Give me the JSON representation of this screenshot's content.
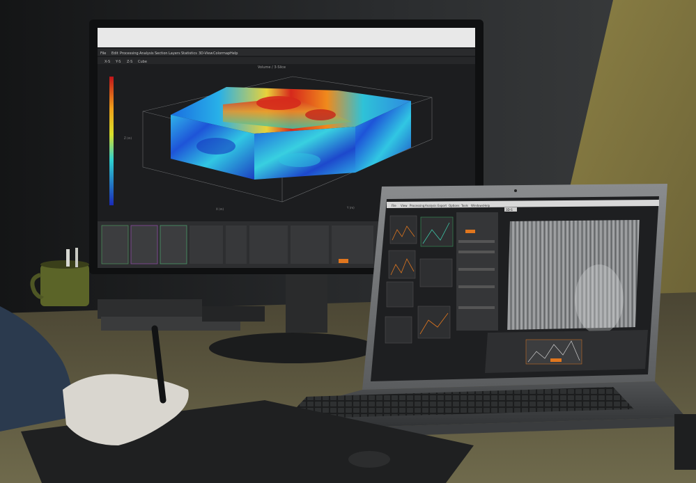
{
  "monitor_app": {
    "title": "",
    "menu": [
      "File",
      "Edit",
      "Processing",
      "Analysis",
      "Section",
      "Layers",
      "Statistics",
      "3D-View",
      "Colormap",
      "Help"
    ],
    "toolbar_tabs": [
      "X-S",
      "Y-S",
      "Z-S",
      "Cube"
    ],
    "plot_title": "Volume / 3-Slice",
    "z_axis_label": "Z (m)",
    "x_axis_label": "X (m)",
    "y_axis_label": "Y (m)"
  },
  "laptop_app": {
    "menu": [
      "File",
      "View",
      "Processing",
      "Analysis",
      "Export",
      "Options",
      "Tools",
      "Windows",
      "Help"
    ],
    "active_tab": "3D-S"
  },
  "colors": {
    "wall": "#232527",
    "desk": "#6e6543",
    "accent_yellow": "#b5a55a",
    "screen_bg": "#1c1d1f",
    "panel_bg": "#3a3b3d",
    "highlight_orange": "#e0761e"
  }
}
